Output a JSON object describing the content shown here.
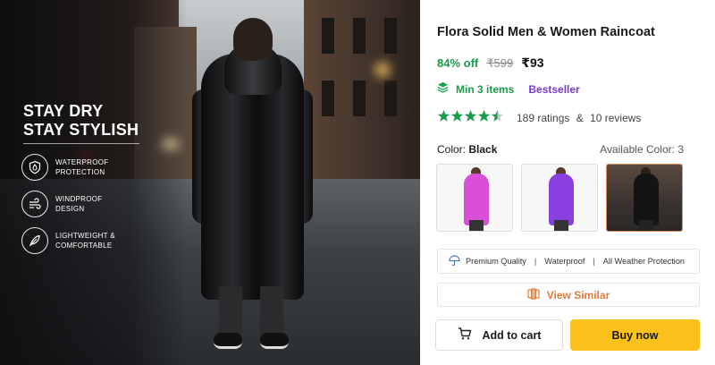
{
  "hero": {
    "headline": [
      "STAY DRY",
      "STAY STYLISH"
    ],
    "features": [
      {
        "icon": "shield-drop-icon",
        "lines": [
          "WATERPROOF",
          "PROTECTION"
        ]
      },
      {
        "icon": "wind-icon",
        "lines": [
          "WINDPROOF",
          "DESIGN"
        ]
      },
      {
        "icon": "feather-icon",
        "lines": [
          "LIGHTWEIGHT &",
          "COMFORTABLE"
        ]
      }
    ]
  },
  "product": {
    "title": "Flora Solid Men & Women Raincoat",
    "discount": "84% off",
    "mrp": "₹599",
    "price": "₹93",
    "min_items": "Min 3 items",
    "bestseller": "Bestseller",
    "rating_stars": 4.5,
    "ratings": "189 ratings",
    "amp": "&",
    "reviews": "10 reviews",
    "color_label": "Color:",
    "color_value": "Black",
    "available_colors": "Available Color: 3",
    "swatches": [
      {
        "color": "Pink",
        "hex": "#d94fd6"
      },
      {
        "color": "Purple",
        "hex": "#8a3fe0"
      },
      {
        "color": "Black",
        "hex": "#141414"
      }
    ],
    "features_bar": [
      "Premium Quality",
      "Waterproof",
      "All Weather Protection"
    ],
    "view_similar": "View Similar",
    "add_to_cart": "Add to cart",
    "buy_now": "Buy now"
  },
  "colors": {
    "green": "#1a9d4a",
    "purple": "#7b3bd0",
    "orange": "#e07a3a",
    "yellow": "#fcc21b"
  }
}
